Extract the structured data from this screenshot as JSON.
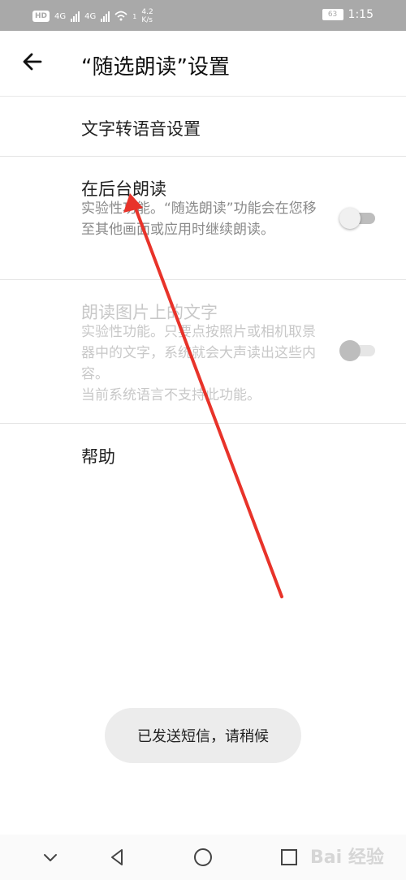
{
  "status_bar": {
    "hd": "HD",
    "net1": "4G",
    "net2": "4G",
    "wifi_sup": "1",
    "speed_value": "4.2",
    "speed_unit": "K/s",
    "battery": "63",
    "time": "1:15",
    "colors": {
      "background": "#a9a9a9"
    }
  },
  "appbar": {
    "title": "“随选朗读”设置",
    "back_icon": "arrow-left-icon"
  },
  "settings": {
    "tts": {
      "title": "文字转语音设置"
    },
    "background_read": {
      "title": "在后台朗读",
      "description": "实验性功能。“随选朗读”功能会在您移至其他画面或应用时继续朗读。",
      "toggle_on": false,
      "enabled": true
    },
    "read_image_text": {
      "title": "朗读图片上的文字",
      "description": "实验性功能。只要点按照片或相机取景器中的文字，系统就会大声读出这些内容。",
      "note": "当前系统语言不支持此功能。",
      "toggle_on": false,
      "enabled": false
    },
    "help": {
      "title": "帮助"
    }
  },
  "toast": {
    "text": "已发送短信，请稍候"
  },
  "navbar": {
    "icons": [
      "chevron-down-icon",
      "back-triangle-icon",
      "home-circle-icon",
      "recents-square-icon"
    ]
  },
  "watermark": {
    "text": "Bai 经验"
  },
  "annotation": {
    "color": "#e8332a"
  }
}
